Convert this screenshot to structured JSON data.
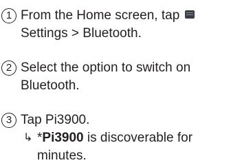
{
  "steps": [
    {
      "number": "1",
      "line1_before_icon": "From the Home screen, tap",
      "icon": "settings-icon",
      "line2": "Settings > Bluetooth."
    },
    {
      "number": "2",
      "line1": "Select the option to switch on",
      "line2": "Bluetooth."
    },
    {
      "number": "3",
      "line1": "Tap Pi3900.",
      "result": {
        "arrow": "↳",
        "prefix": "*",
        "device": "Pi3900",
        "line1_rest": " is discoverable for",
        "line2": "minutes."
      }
    }
  ]
}
